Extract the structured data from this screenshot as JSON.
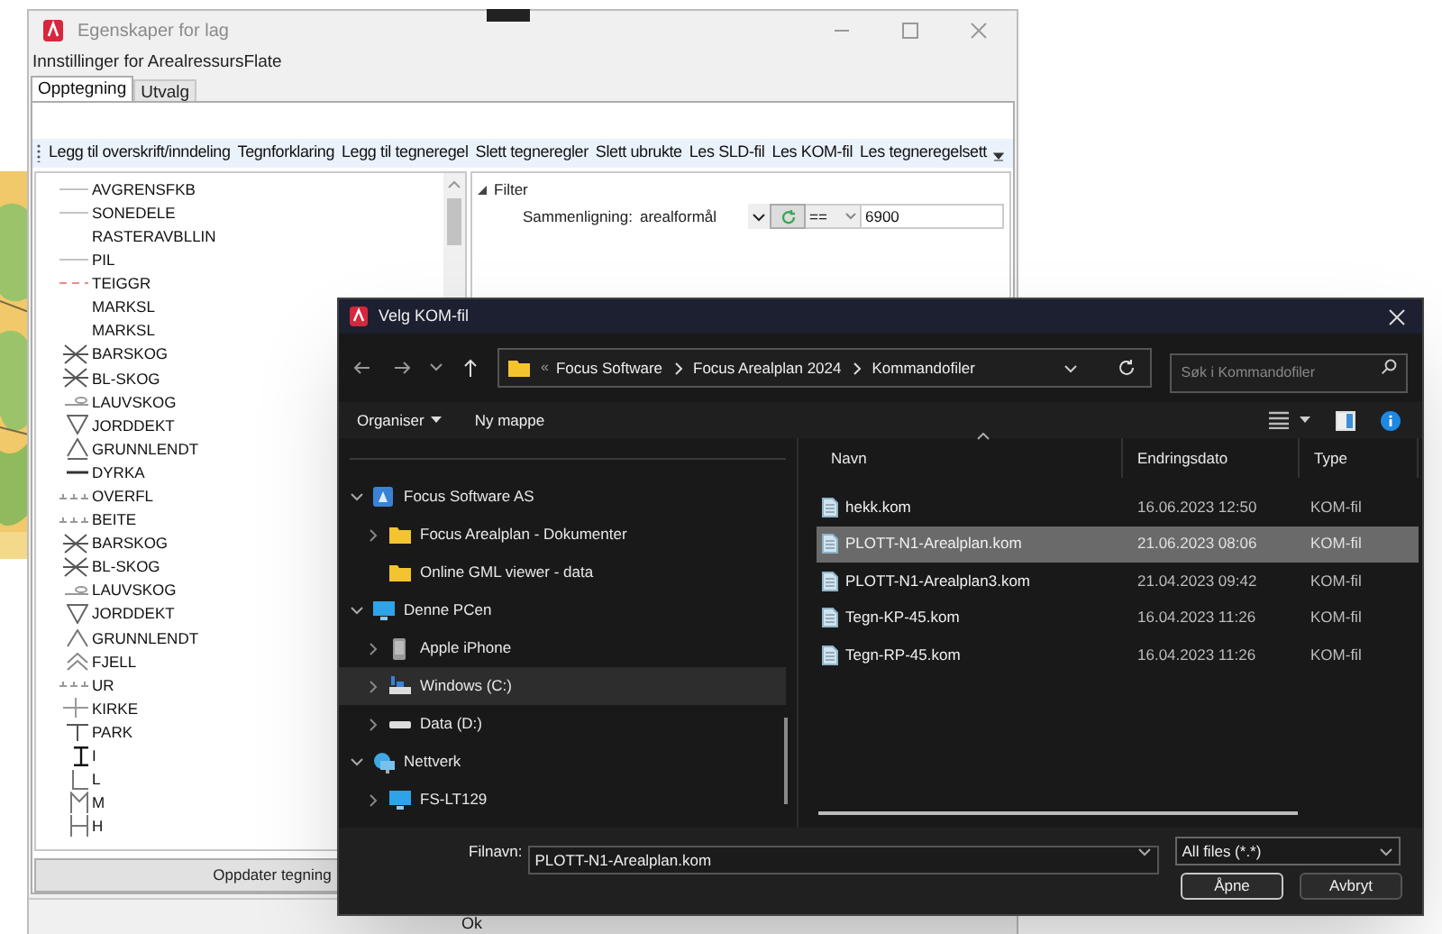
{
  "properties_window": {
    "title": "Egenskaper for lag",
    "subtitle": "Innstillinger for ArealressursFlate",
    "tabs": [
      {
        "label": "Opptegning",
        "selected": true
      },
      {
        "label": "Utvalg",
        "selected": false
      }
    ],
    "toolbar": [
      "Legg til overskrift/inndeling",
      "Tegnforklaring",
      "Legg til tegneregel",
      "Slett tegneregler",
      "Slett ubrukte",
      "Les SLD-fil",
      "Les KOM-fil",
      "Les tegneregelsett"
    ],
    "symbols": [
      {
        "label": "AVGRENSFKB",
        "kind": "line"
      },
      {
        "label": "SONEDELE",
        "kind": "line"
      },
      {
        "label": "RASTERAVBLLIN",
        "kind": "none"
      },
      {
        "label": "PIL",
        "kind": "line"
      },
      {
        "label": "TEIGGR",
        "kind": "dash"
      },
      {
        "label": "MARKSL",
        "kind": "none"
      },
      {
        "label": "MARKSL",
        "kind": "none"
      },
      {
        "label": "BARSKOG",
        "kind": "cross"
      },
      {
        "label": "BL-SKOG",
        "kind": "cross"
      },
      {
        "label": "LAUVSKOG",
        "kind": "leaf"
      },
      {
        "label": "JORDDEKT",
        "kind": "down"
      },
      {
        "label": "GRUNNLENDT",
        "kind": "up"
      },
      {
        "label": "DYRKA",
        "kind": "thick"
      },
      {
        "label": "OVERFL",
        "kind": "marsh"
      },
      {
        "label": "BEITE",
        "kind": "marsh"
      },
      {
        "label": "BARSKOG",
        "kind": "cross"
      },
      {
        "label": "BL-SKOG",
        "kind": "cross"
      },
      {
        "label": "LAUVSKOG",
        "kind": "leaf"
      },
      {
        "label": "JORDDEKT",
        "kind": "down"
      },
      {
        "label": "GRUNNLENDT",
        "kind": "caret"
      },
      {
        "label": "FJELL",
        "kind": "chevrons"
      },
      {
        "label": "UR",
        "kind": "marsh"
      },
      {
        "label": "KIRKE",
        "kind": "plus"
      },
      {
        "label": "PARK",
        "kind": "tee"
      },
      {
        "label": "I",
        "kind": "ibeam"
      },
      {
        "label": "L",
        "kind": "ell"
      },
      {
        "label": "M",
        "kind": "em"
      },
      {
        "label": "H",
        "kind": "aitch"
      }
    ],
    "filter": {
      "heading": "Filter",
      "label": "Sammenligning:",
      "field": "arealformål",
      "operator": "==",
      "value": "6900"
    },
    "update_button": "Oppdater tegning",
    "status_text": "Ok"
  },
  "file_dialog": {
    "title": "Velg KOM-fil",
    "overflow": "«",
    "breadcrumb": [
      "Focus Software",
      "Focus Arealplan 2024",
      "Kommandofiler"
    ],
    "search": {
      "placeholder": "Søk i Kommandofiler"
    },
    "commands": [
      {
        "label": "Organiser",
        "menu": true
      },
      {
        "label": "Ny mappe",
        "menu": false
      }
    ],
    "tree": [
      {
        "label": "Focus Software AS",
        "kind": "cloud",
        "expanded": true,
        "selected": false,
        "children": [
          {
            "label": "Focus Arealplan - Dokumenter",
            "kind": "folder",
            "expanded": false,
            "selected": false
          },
          {
            "label": "Online GML viewer - data",
            "kind": "folder",
            "selected": false
          }
        ]
      },
      {
        "label": "Denne PCen",
        "kind": "pc",
        "expanded": true,
        "selected": false,
        "children": [
          {
            "label": "Apple iPhone",
            "kind": "phone",
            "expanded": false,
            "selected": false
          },
          {
            "label": "Windows (C:)",
            "kind": "system",
            "expanded": false,
            "selected": true
          },
          {
            "label": "Data (D:)",
            "kind": "drive",
            "expanded": false,
            "selected": false
          }
        ]
      },
      {
        "label": "Nettverk",
        "kind": "network",
        "expanded": true,
        "selected": false,
        "children": [
          {
            "label": "FS-LT129",
            "kind": "pc",
            "expanded": false,
            "selected": false
          }
        ]
      }
    ],
    "columns": [
      "Navn",
      "Endringsdato",
      "Type"
    ],
    "rows": [
      {
        "name": "hekk.kom",
        "date": "16.06.2023 12:50",
        "type": "KOM-fil",
        "selected": false
      },
      {
        "name": "PLOTT-N1-Arealplan.kom",
        "date": "21.06.2023 08:06",
        "type": "KOM-fil",
        "selected": true
      },
      {
        "name": "PLOTT-N1-Arealplan3.kom",
        "date": "21.04.2023 09:42",
        "type": "KOM-fil",
        "selected": false
      },
      {
        "name": "Tegn-KP-45.kom",
        "date": "16.04.2023 11:26",
        "type": "KOM-fil",
        "selected": false
      },
      {
        "name": "Tegn-RP-45.kom",
        "date": "16.04.2023 11:26",
        "type": "KOM-fil",
        "selected": false
      }
    ],
    "filename": {
      "label": "Filnavn:",
      "value": "PLOTT-N1-Arealplan.kom"
    },
    "file_type": "All files (*.*)",
    "buttons": [
      "Åpne",
      "Avbryt"
    ]
  }
}
